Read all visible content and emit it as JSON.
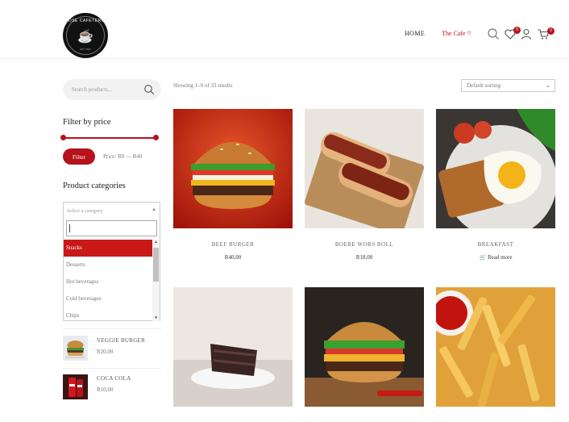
{
  "brand": {
    "logo_text": "ROSE CAFETERIA",
    "logo_sub": "EST. 2021"
  },
  "nav": {
    "home": "HOME",
    "cafe": "The Cafe",
    "wishlist_count": "0",
    "cart_count": "0"
  },
  "sidebar": {
    "search_placeholder": "Search products...",
    "filter_heading": "Filter by price",
    "filter_button": "Filter",
    "price_range": "Price: R0 — R40",
    "categories_heading": "Product categories",
    "category_select": "Select a category",
    "category_options": [
      "Snacks",
      "Desserts",
      "Hot beverages",
      "Cold beverages",
      "Chips"
    ],
    "recent_products": [
      {
        "name": "VEGGIE BURGER",
        "price": "R20,00"
      },
      {
        "name": "COCA COLA",
        "price": "R10,00"
      }
    ]
  },
  "shop": {
    "results_text": "Showing 1–9 of 33 results",
    "sorting": "Default sorting",
    "products": [
      {
        "name": "BEEF BURGER",
        "price": "R40,00"
      },
      {
        "name": "BOERE WORS ROLL",
        "price": "R18,00"
      },
      {
        "name": "BREAKFAST",
        "action": "Read more"
      }
    ]
  },
  "colors": {
    "accent": "#b5121b",
    "dropdown_highlight": "#c81818"
  }
}
